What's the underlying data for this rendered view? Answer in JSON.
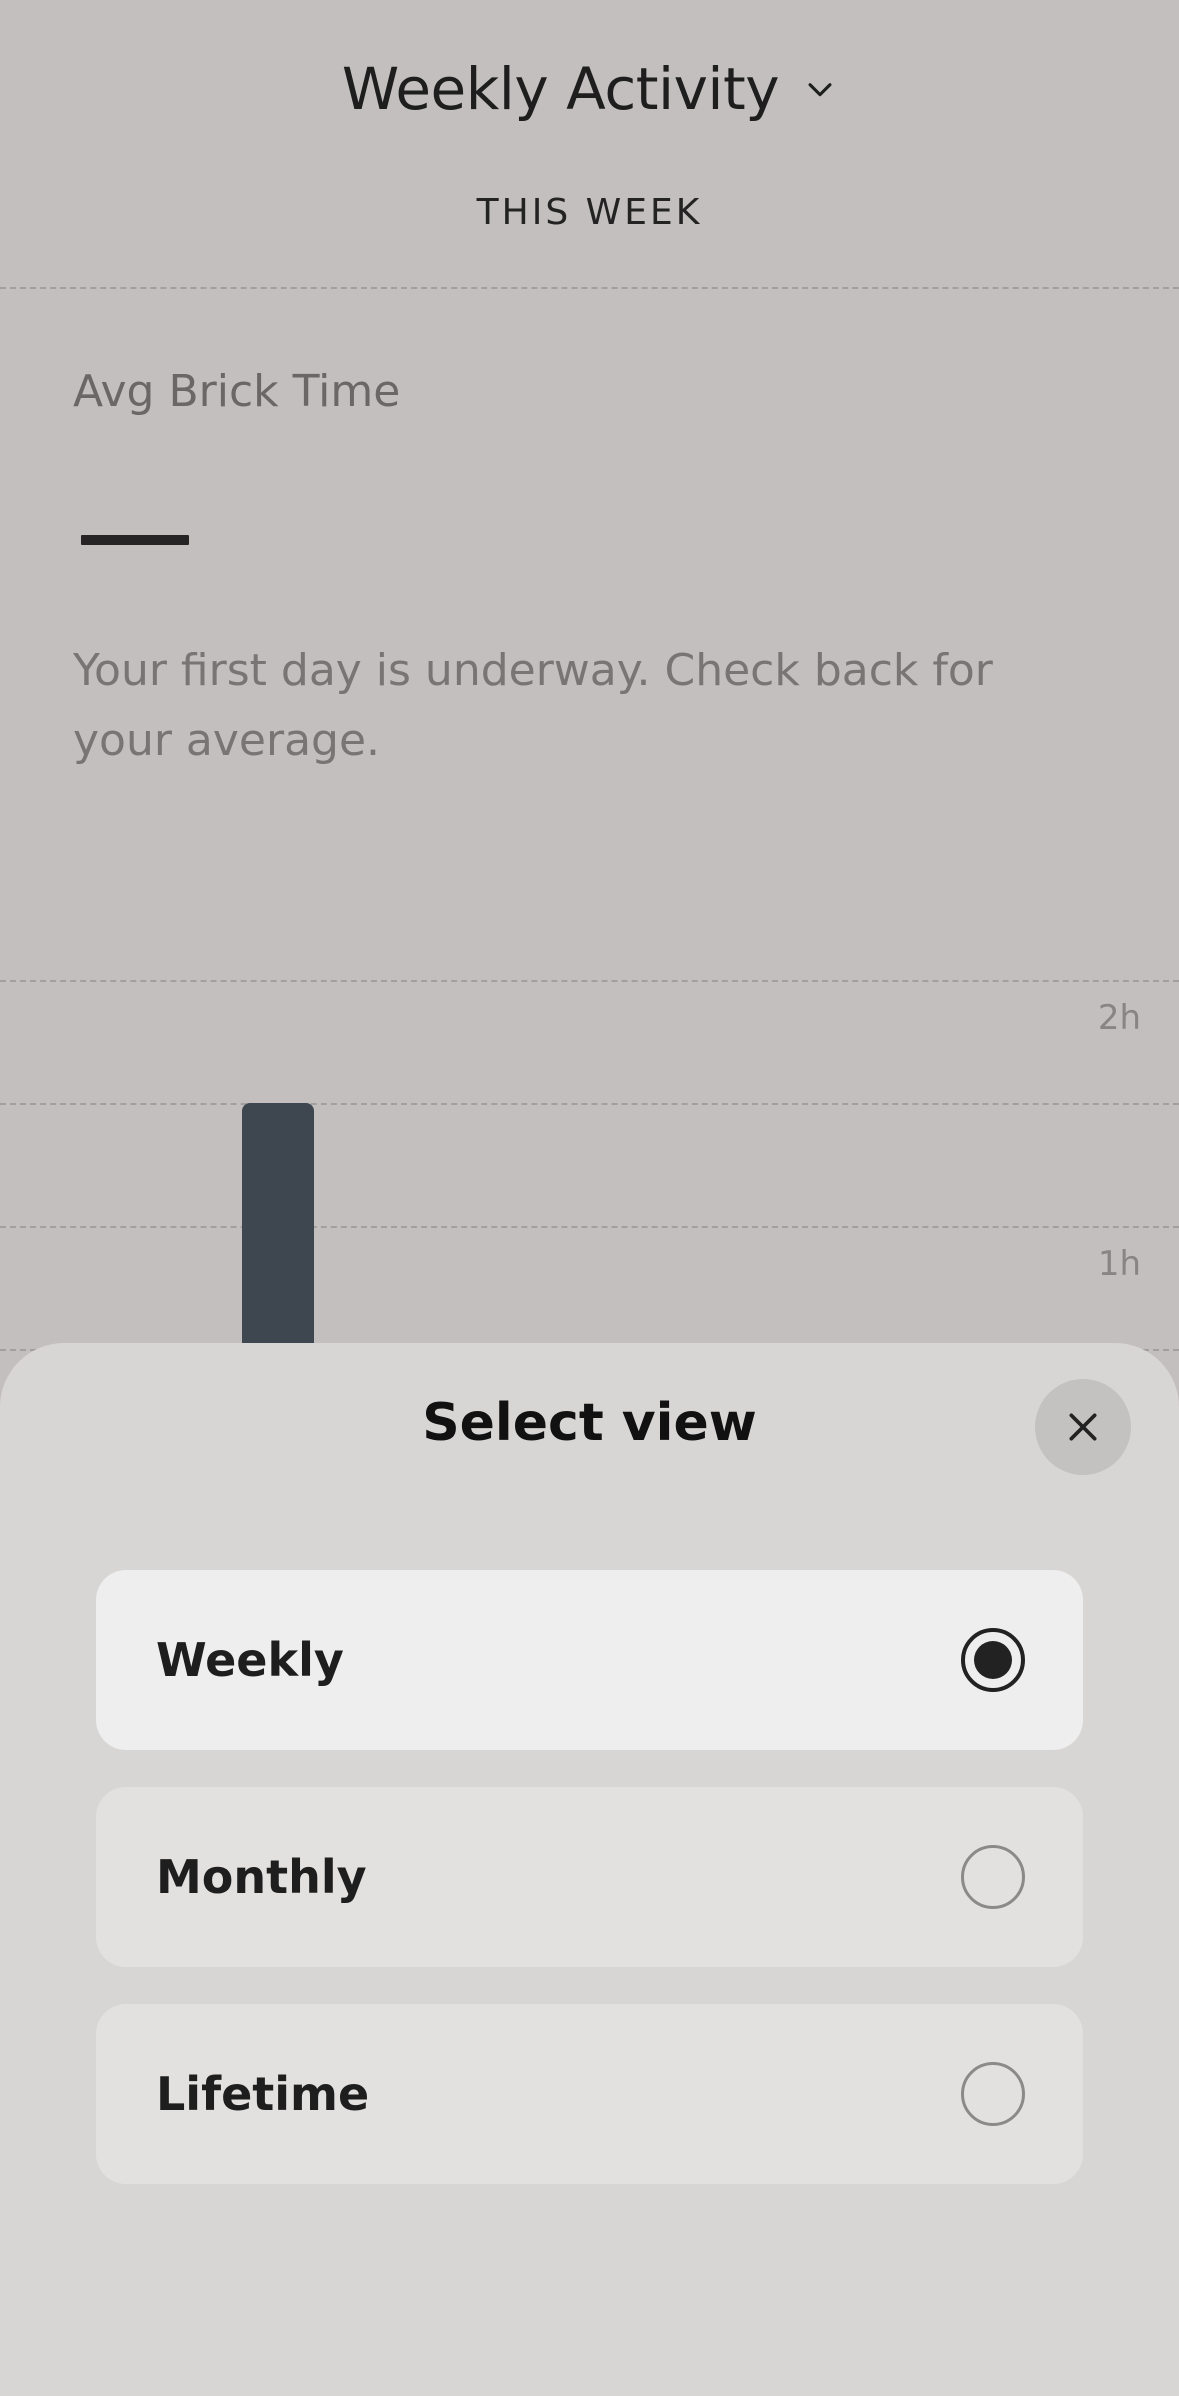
{
  "header": {
    "title": "Weekly Activity",
    "period": "THIS WEEK"
  },
  "metric": {
    "label": "Avg Brick Time",
    "value_placeholder": "—",
    "note": "Your first day is underway. Check back for your average."
  },
  "chart_data": {
    "type": "bar",
    "y_ticks": [
      "2h",
      "1h"
    ],
    "ylim_hours": [
      0,
      2
    ],
    "values_hours": [
      1.5
    ]
  },
  "sheet": {
    "title": "Select view",
    "options": [
      {
        "label": "Weekly",
        "selected": true
      },
      {
        "label": "Monthly",
        "selected": false
      },
      {
        "label": "Lifetime",
        "selected": false
      }
    ]
  },
  "icons": {
    "title_dropdown": "chevron-down-icon",
    "close": "close-icon"
  },
  "colors": {
    "overlay_background": "#c4bfbf",
    "sheet_background": "#d8d5d5",
    "bar": "#3e4650",
    "selected_option": "#eeeeee",
    "option": "#e3e1e0"
  }
}
